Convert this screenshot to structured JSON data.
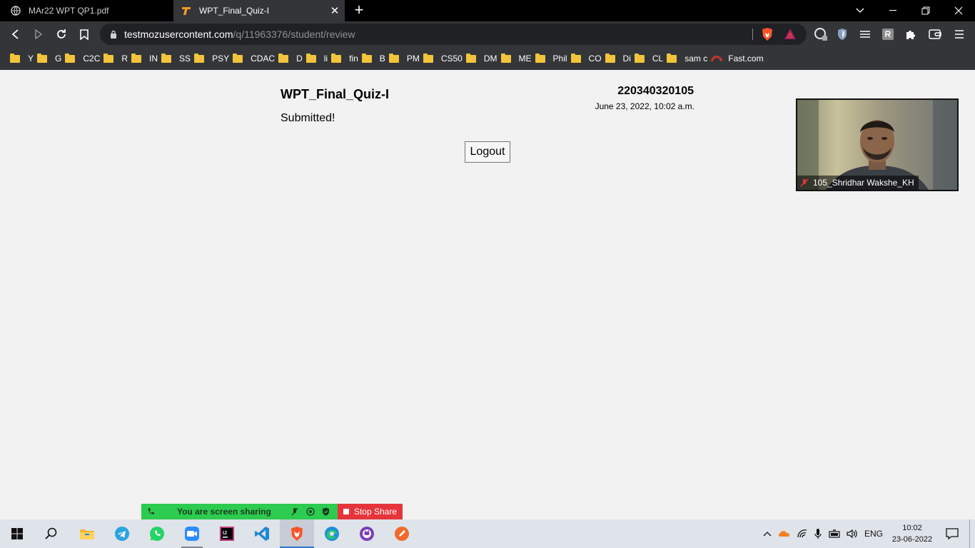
{
  "tabs": [
    {
      "title": "MAr22 WPT QP1.pdf",
      "favicon": "globe-icon"
    },
    {
      "title": "WPT_Final_Quiz-I",
      "favicon": "testmoz-t-icon"
    }
  ],
  "address": {
    "host": "testmozusercontent.com",
    "path": "/q/11963376/student/review"
  },
  "bookmarks": [
    "Y",
    "G",
    "C2C",
    "R",
    "IN",
    "SS",
    "PSY",
    "CDAC",
    "D",
    "li",
    "fin",
    "B",
    "PM",
    "CS50",
    "DM",
    "ME",
    "Phil",
    "CO",
    "Di",
    "CL",
    "sam c",
    "Fast.com"
  ],
  "quiz": {
    "title": "WPT_Final_Quiz-I",
    "status": "Submitted!",
    "student_id": "220340320105",
    "submitted_at": "June 23, 2022, 10:02 a.m.",
    "logout_label": "Logout"
  },
  "video": {
    "participant_name": "105_Shridhar Wakshe_KH"
  },
  "share_bar": {
    "status_text": "You are screen sharing",
    "stop_label": "Stop Share"
  },
  "taskbar": {
    "language": "ENG",
    "time": "10:02",
    "date": "23-06-2022"
  },
  "colors": {
    "page_bg": "#f2f2f2",
    "browser_chrome": "#333538",
    "share_green": "#2dcb4f",
    "stop_red": "#e5353b"
  }
}
